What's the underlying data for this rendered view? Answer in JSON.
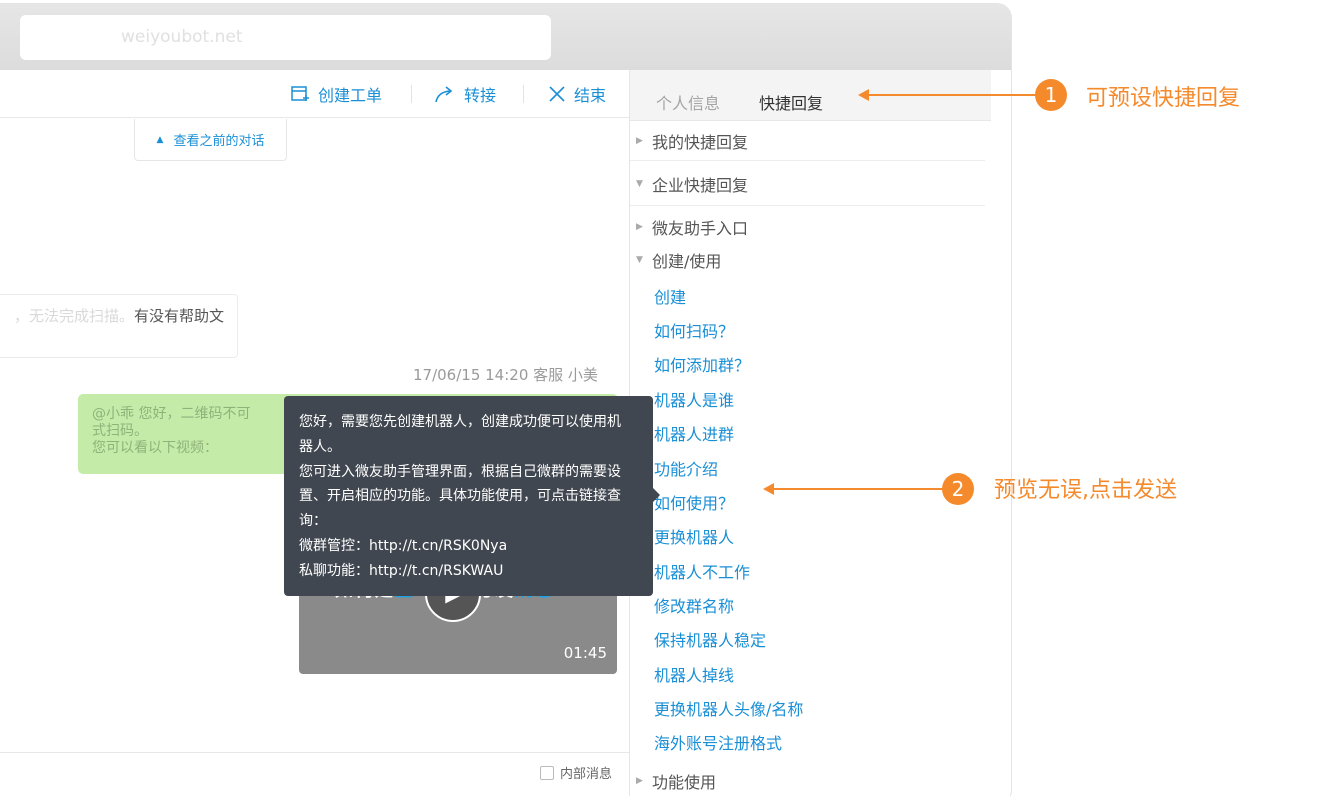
{
  "browser": {
    "url": "weiyoubot.net"
  },
  "toolbar": {
    "create_ticket": "创建工单",
    "transfer": "转接",
    "end": "结束"
  },
  "chat": {
    "view_history": "查看之前的对话",
    "incoming_faint": "，无法完成扫描。",
    "incoming_text": "有没有帮助文",
    "meta": "17/06/15 14:20   客服 小美",
    "outgoing_lines": [
      "@小乖 您好，二维码不可",
      "式扫码。",
      "您可以看以下视频："
    ],
    "video_title_a": "如何建",
    "video_title_b": "立",
    "video_title_c": "与发",
    "video_title_d": "消息",
    "video_duration": "01:45",
    "internal_label": "内部消息"
  },
  "tooltip": {
    "lines": [
      "您好，需要您先创建机器人，创建成功便可以使用机",
      "器人。",
      "您可进入微友助手管理界面，根据自己微群的需要设",
      "置、开启相应的功能。具体功能使用，可点击链接查",
      "询：",
      "微群管控：http://t.cn/RSK0Nya",
      "私聊功能：http://t.cn/RSKWAU"
    ]
  },
  "panel": {
    "tabs": [
      {
        "label": "个人信息",
        "active": false
      },
      {
        "label": "快捷回复",
        "active": true
      }
    ],
    "groups": {
      "mine": "我的快捷回复",
      "company": "企业快捷回复",
      "entry": "微友助手入口",
      "create_use": "创建/使用",
      "func_use": "功能使用"
    },
    "items": [
      "创建",
      "如何扫码？",
      "如何添加群？",
      "机器人是谁",
      "机器人进群",
      "功能介绍",
      "如何使用？",
      "更换机器人",
      "机器人不工作",
      "修改群名称",
      "保持机器人稳定",
      "机器人掉线",
      "更换机器人头像/名称",
      "海外账号注册格式"
    ]
  },
  "annotations": [
    {
      "num": "1",
      "text": "可预设快捷回复"
    },
    {
      "num": "2",
      "text": "预览无误,点击发送"
    }
  ],
  "colors": {
    "accent": "#1a8fd6",
    "annotation": "#f58a2c",
    "tooltip_bg": "#414750",
    "outgoing_bubble": "#c5eba9"
  }
}
